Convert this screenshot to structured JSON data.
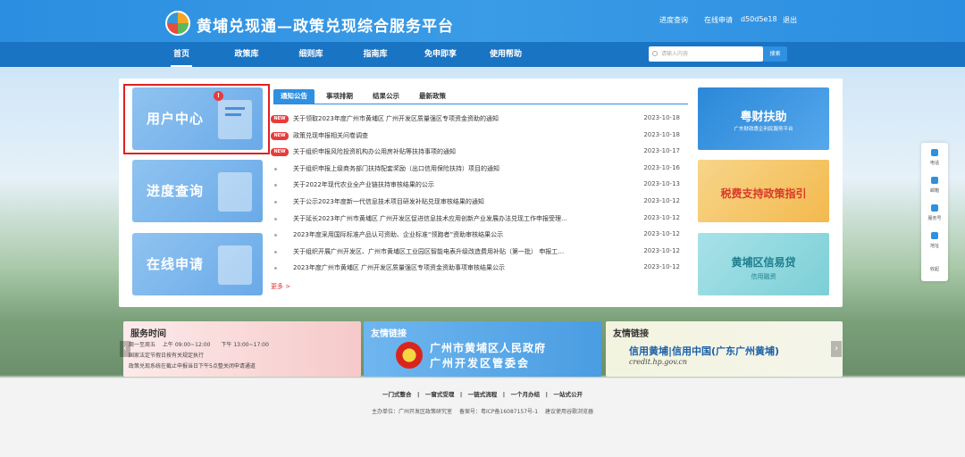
{
  "header": {
    "title": "黄埔兑现通—政策兑现综合服务平台",
    "links": {
      "progress": "进度查询",
      "online": "在线申请",
      "user": "d50d5e18",
      "logout": "退出"
    }
  },
  "nav": {
    "items": [
      "首页",
      "政策库",
      "细则库",
      "指南库",
      "免申即享",
      "使用帮助"
    ],
    "search_placeholder": "请输入内容",
    "search_button": "搜索"
  },
  "cards": [
    {
      "title": "用户中心",
      "badge": "!"
    },
    {
      "title": "进度查询"
    },
    {
      "title": "在线申请"
    }
  ],
  "tabs": [
    "通知公告",
    "事项排期",
    "结果公示",
    "最新政策"
  ],
  "news_tag": "NEW",
  "news": [
    {
      "title": "关于领取2023年度广州市黄埔区 广州开发区质量强区专项资金资助的通知",
      "date": "2023-10-18",
      "new": true
    },
    {
      "title": "政策兑现申报相关问卷调查",
      "date": "2023-10-18",
      "new": true
    },
    {
      "title": "关于组织申报风险投资机构办公用房补贴等扶持事项的通知",
      "date": "2023-10-17",
      "new": true
    },
    {
      "title": "关于组织申报上级商务部门扶持配套奖励（出口信用保险扶持）项目的通知",
      "date": "2023-10-16",
      "new": false
    },
    {
      "title": "关于2022年现代农业全产业链扶持审核结果的公示",
      "date": "2023-10-13",
      "new": false
    },
    {
      "title": "关于公示2023年度新一代信息技术项目研发补贴兑现审核结果的通知",
      "date": "2023-10-12",
      "new": false
    },
    {
      "title": "关于延长2023年广州市黄埔区 广州开发区促进信息技术应用创新产业发展办法兑现工作申报受理…",
      "date": "2023-10-12",
      "new": false
    },
    {
      "title": "2023年度采用国际标准产品认可资助、企业标准“领跑者”资助审核结果公示",
      "date": "2023-10-12",
      "new": false
    },
    {
      "title": "关于组织开展广州开发区、广州市黄埔区工业园区智能电表升级改造费用补贴（第一批） 申报工…",
      "date": "2023-10-12",
      "new": false
    },
    {
      "title": "2023年度广州市黄埔区 广州开发区质量强区专项资金资助事项审核结果公示",
      "date": "2023-10-12",
      "new": false
    }
  ],
  "more": "更多 >",
  "banners": [
    {
      "title": "粤财扶助",
      "sub": "广东财政惠企利民服务平台"
    },
    {
      "title": "税费支持政策指引"
    },
    {
      "title": "黄埔区信易贷",
      "sub": "信用融资"
    }
  ],
  "service": {
    "title": "服务时间",
    "line1": "周一至周五　 上午 09:00~12:00　　下午 13:00~17:00",
    "line2": "国家法定节假日按有关规定执行",
    "line3": "政策兑现系统在截止申报当日下午5点整关闭申请通道"
  },
  "friend1": {
    "title": "友情链接",
    "line1": "广州市黄埔区人民政府",
    "line2": "广州开发区管委会"
  },
  "friend2": {
    "title": "友情链接",
    "line1": "信用黄埔|信用中国(广东广州黄埔)",
    "line2": "credit.hp.gov.cn"
  },
  "arrows": {
    "left": "‹",
    "right": "›"
  },
  "footer": {
    "slogan": "一门式整合　|　一窗式受理　|　一链式流程　|　一个月办结　|　一站式公开",
    "host": "主办单位：广州开发区政策研究室",
    "icp": "备案号：粤ICP备16087157号-1",
    "browser": "建议使用谷歌浏览器"
  },
  "side": [
    "电话",
    "邮箱",
    "服务号",
    "地址",
    "收起"
  ]
}
